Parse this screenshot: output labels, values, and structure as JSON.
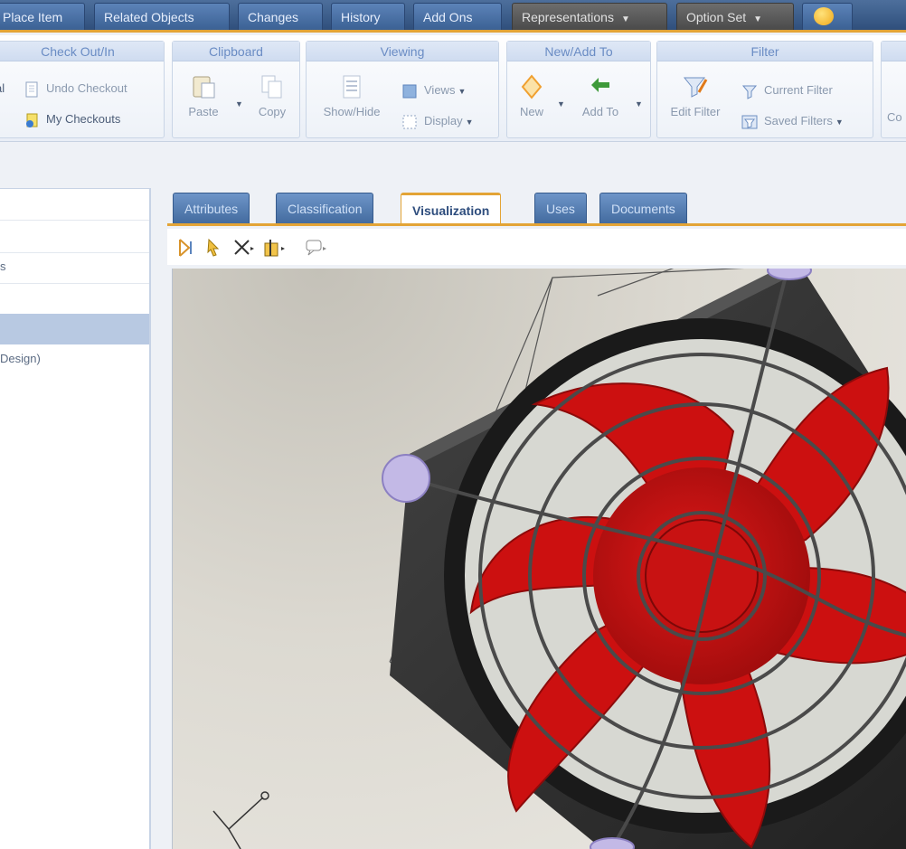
{
  "top_tabs": [
    {
      "label": "Place Item",
      "style": "blue"
    },
    {
      "label": "Related Objects",
      "style": "blue"
    },
    {
      "label": "Changes",
      "style": "blue"
    },
    {
      "label": "History",
      "style": "blue"
    },
    {
      "label": "Add Ons",
      "style": "blue"
    },
    {
      "label": "Representations",
      "style": "dark"
    },
    {
      "label": "Option Set",
      "style": "dark"
    }
  ],
  "ribbon": {
    "check_out": {
      "title": "Check Out/In",
      "items": [
        "Undo Checkout",
        "My Checkouts"
      ],
      "left_clip_label": "al"
    },
    "clipboard": {
      "title": "Clipboard",
      "paste": "Paste",
      "copy": "Copy"
    },
    "viewing": {
      "title": "Viewing",
      "show_hide": "Show/Hide",
      "views": "Views",
      "display": "Display"
    },
    "new_add": {
      "title": "New/Add To",
      "new": "New",
      "add_to": "Add To"
    },
    "filter": {
      "title": "Filter",
      "edit_filter": "Edit Filter",
      "current_filter": "Current Filter",
      "saved_filters": "Saved Filters"
    },
    "right_clip_label": "Co"
  },
  "left_panel": {
    "row1": "s",
    "row2": "Design)"
  },
  "sub_tabs": [
    {
      "label": "Attributes",
      "active": false
    },
    {
      "label": "Classification",
      "active": false
    },
    {
      "label": "Visualization",
      "active": true
    },
    {
      "label": "Uses",
      "active": false
    },
    {
      "label": "Documents",
      "active": false
    }
  ],
  "viewer_tools": [
    "fit-icon",
    "select-icon",
    "measure-icon",
    "section-icon",
    "comment-icon"
  ],
  "colors": {
    "accent": "#e3a436",
    "blade": "#cc1010",
    "frame": "#2a2a2a"
  }
}
